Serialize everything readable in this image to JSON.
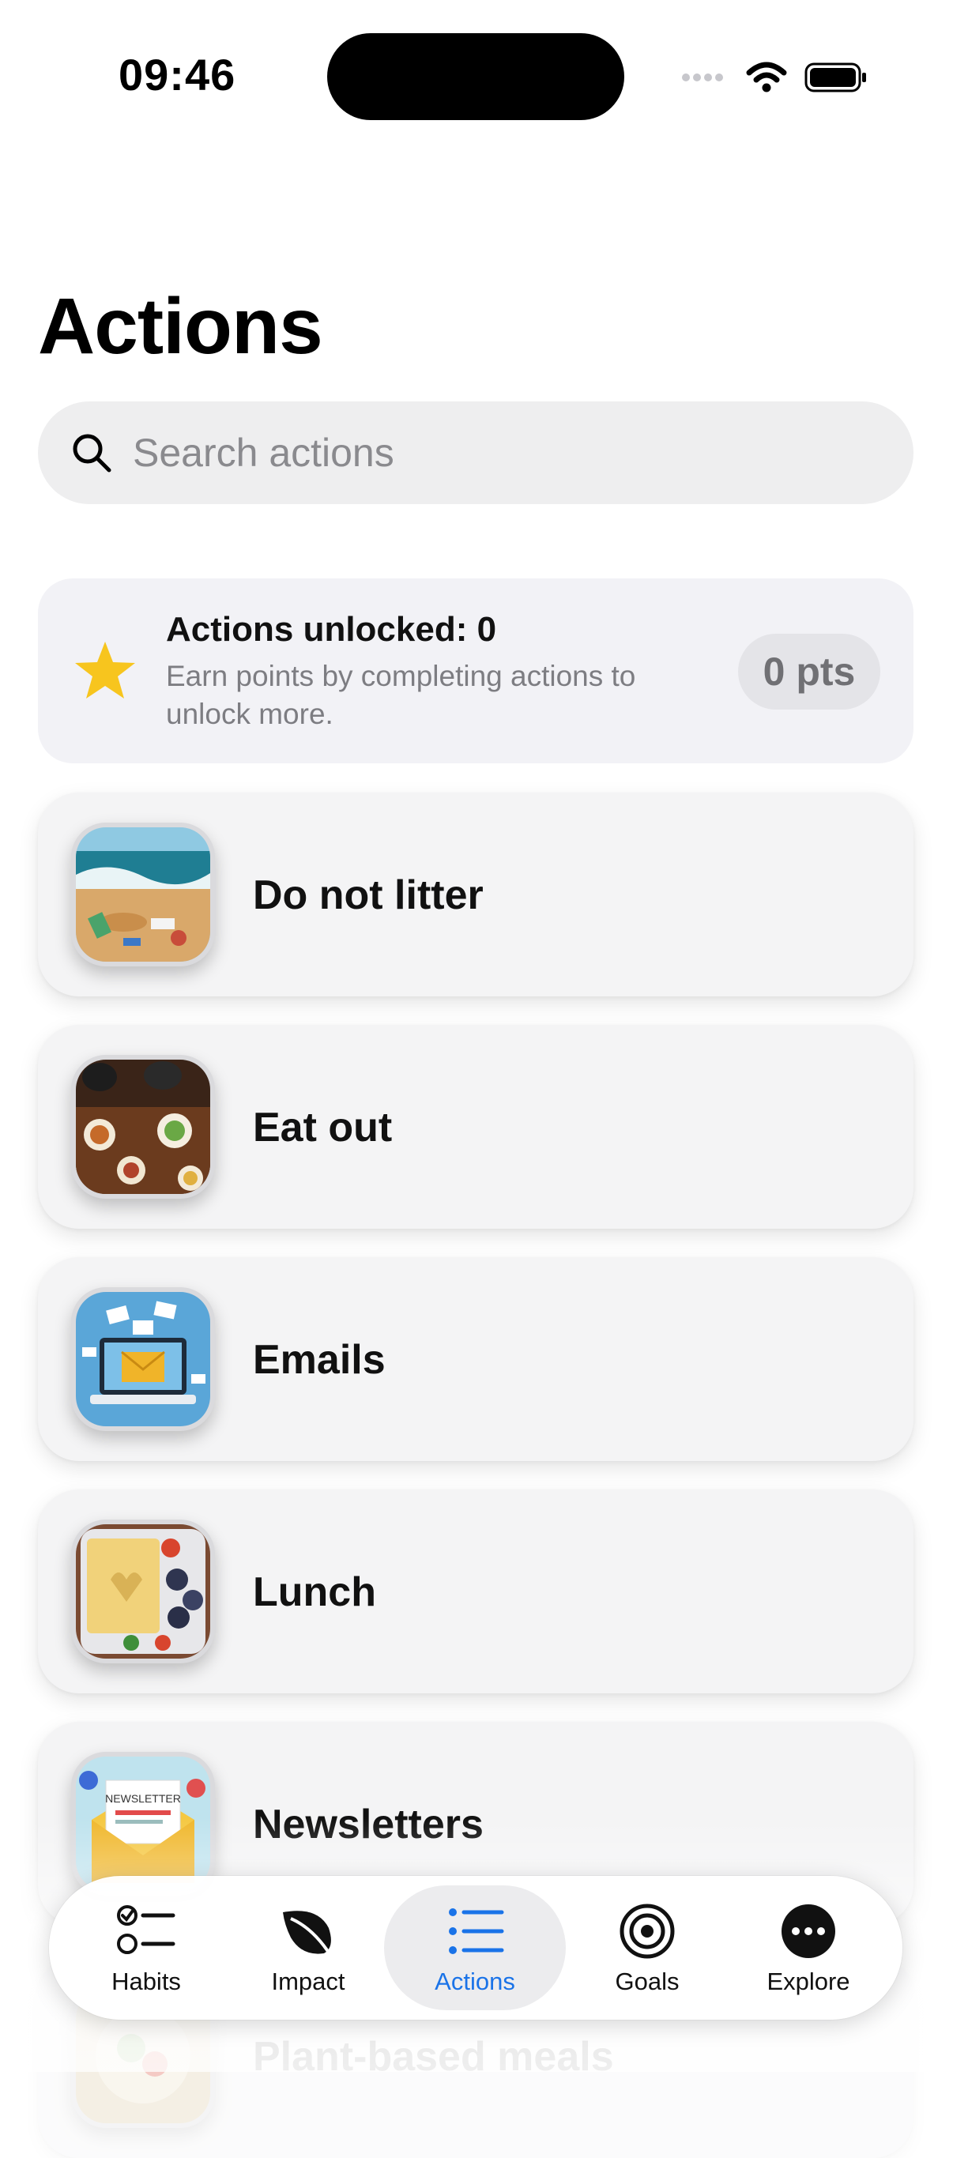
{
  "status_bar": {
    "time": "09:46"
  },
  "page": {
    "title": "Actions"
  },
  "search": {
    "placeholder": "Search actions",
    "value": ""
  },
  "unlock_card": {
    "title": "Actions unlocked: 0",
    "subtitle": "Earn points by completing actions to unlock more.",
    "points": "0 pts"
  },
  "actions": [
    {
      "label": "Do not litter",
      "icon": "beach-litter-photo"
    },
    {
      "label": "Eat out",
      "icon": "restaurant-table-photo"
    },
    {
      "label": "Emails",
      "icon": "laptop-email-illustration"
    },
    {
      "label": "Lunch",
      "icon": "lunchbox-photo"
    },
    {
      "label": "Newsletters",
      "icon": "newsletter-illustration"
    },
    {
      "label": "Plant-based meals",
      "icon": "plant-meal-photo"
    }
  ],
  "newsletter_art_text": "NEWSLETTER",
  "tabbar": {
    "tabs": [
      {
        "label": "Habits",
        "icon": "checklist-icon"
      },
      {
        "label": "Impact",
        "icon": "leaf-icon"
      },
      {
        "label": "Actions",
        "icon": "list-icon",
        "active": true
      },
      {
        "label": "Goals",
        "icon": "target-icon"
      },
      {
        "label": "Explore",
        "icon": "ellipsis-circle-icon"
      }
    ]
  },
  "colors": {
    "accent": "#1a73e8",
    "star": "#f7c51e",
    "card_bg": "#f4f4f5"
  }
}
